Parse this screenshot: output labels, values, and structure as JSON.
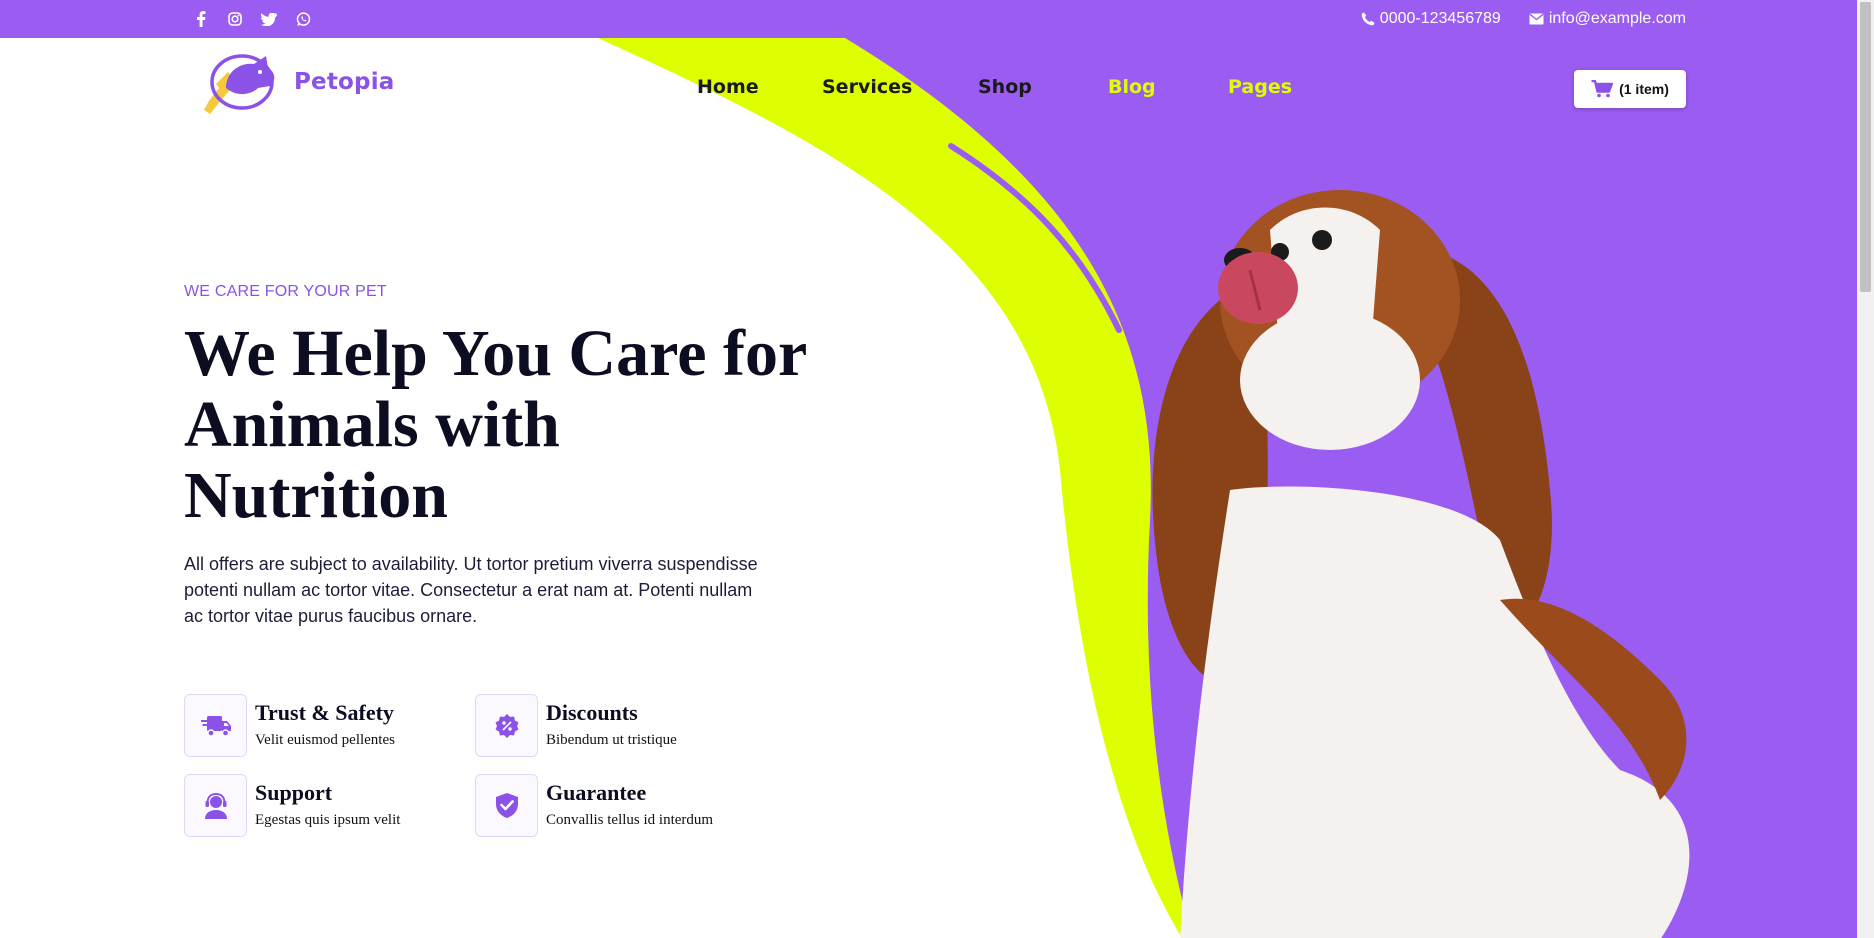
{
  "colors": {
    "accent_purple": "#9b5cf2",
    "brand_purple": "#8a52e6",
    "lime": "#ddff00",
    "nav_dark": "#1a1a1a",
    "nav_yellow": "#ddff00",
    "heading": "#0d0d22"
  },
  "topbar": {
    "social_icons": [
      "facebook-icon",
      "instagram-icon",
      "twitter-icon",
      "whatsapp-icon"
    ],
    "phone": "0000-123456789",
    "email": "info@example.com"
  },
  "header": {
    "brand": "Petopia",
    "nav": [
      {
        "label": "Home",
        "tone": "dark"
      },
      {
        "label": "Services",
        "tone": "dark"
      },
      {
        "label": "Shop",
        "tone": "dark"
      },
      {
        "label": "Blog",
        "tone": "yellow"
      },
      {
        "label": "Pages",
        "tone": "yellow"
      }
    ],
    "cart_label": "(1 item)"
  },
  "hero": {
    "eyebrow": "WE CARE FOR YOUR PET",
    "headline": "We Help You Care for Animals with Nutrition",
    "lead": "All offers are subject to availability. Ut tortor pretium viverra suspendisse potenti nullam ac tortor vitae. Consectetur a erat nam at. Potenti nullam ac tortor vitae purus faucibus ornare.",
    "features": [
      {
        "title": "Trust & Safety",
        "desc": "Velit euismod pellentes",
        "icon": "truck-icon"
      },
      {
        "title": "Discounts",
        "desc": "Bibendum ut tristique",
        "icon": "discount-badge-icon"
      },
      {
        "title": "Support",
        "desc": "Egestas quis ipsum velit",
        "icon": "support-agent-icon"
      },
      {
        "title": "Guarantee",
        "desc": "Convallis tellus id interdum",
        "icon": "shield-check-icon"
      }
    ]
  }
}
